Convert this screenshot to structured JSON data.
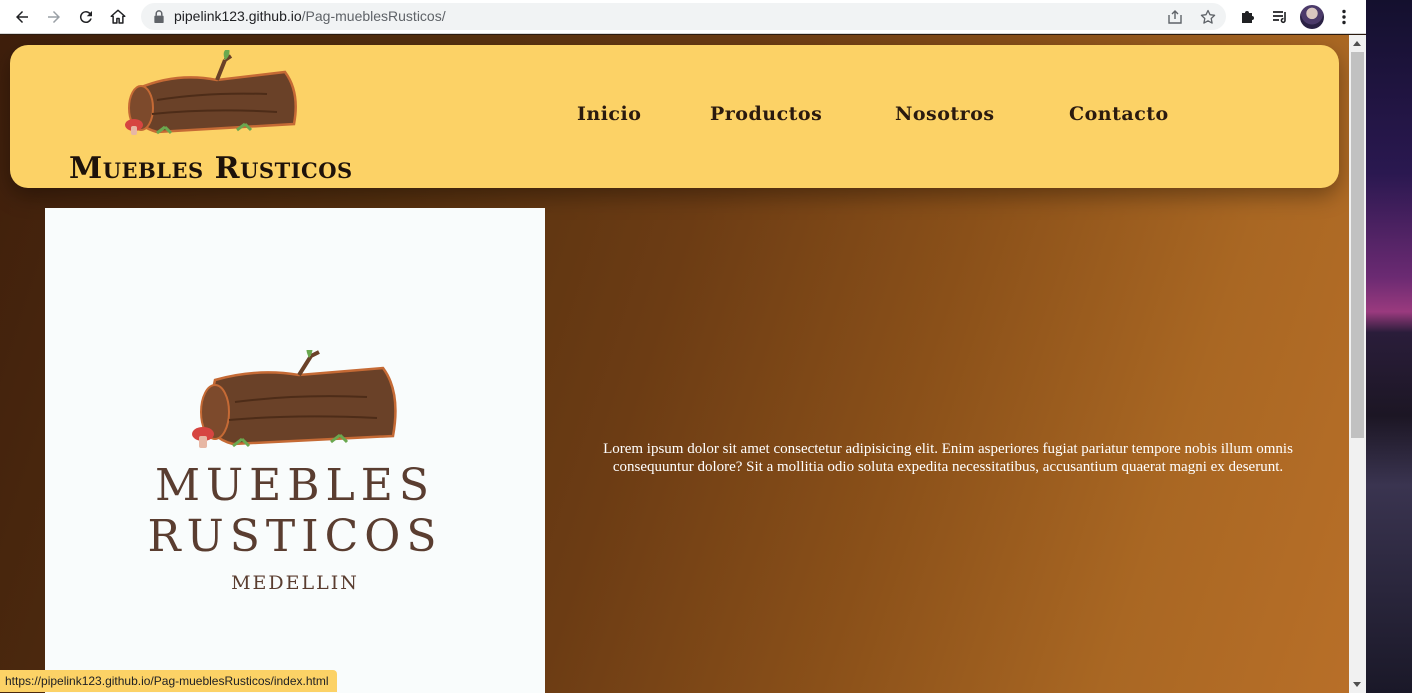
{
  "browser": {
    "url_host": "pipelink123.github.io",
    "url_path": "/Pag-mueblesRusticos/",
    "status_url": "https://pipelink123.github.io/Pag-mueblesRusticos/index.html"
  },
  "site": {
    "brand": "Muebles Rusticos",
    "menu": [
      {
        "label": "Inicio"
      },
      {
        "label": "Productos"
      },
      {
        "label": "Nosotros"
      },
      {
        "label": "Contacto"
      }
    ],
    "card": {
      "title_line1": "MUEBLES",
      "title_line2": "RUSTICOS",
      "subtitle": "MEDELLIN"
    },
    "lorem": "Lorem ipsum dolor sit amet consectetur adipisicing elit. Enim asperiores fugiat pariatur tempore nobis illum omnis consequuntur dolore? Sit a mollitia odio soluta expedita necessitatibus, accusantium quaerat magni ex deserunt."
  },
  "colors": {
    "header_bg": "#fcd266",
    "text_dark": "#1d120a",
    "card_bg": "#f9fcfc",
    "card_text": "#5a3d30"
  },
  "icons": {
    "back": "back-arrow-icon",
    "forward": "forward-arrow-icon",
    "reload": "reload-icon",
    "home": "home-icon",
    "lock": "lock-icon",
    "share": "share-icon",
    "bookmark": "star-icon",
    "extensions": "puzzle-icon",
    "reading_list": "reading-list-icon",
    "menu": "kebab-menu-icon"
  }
}
